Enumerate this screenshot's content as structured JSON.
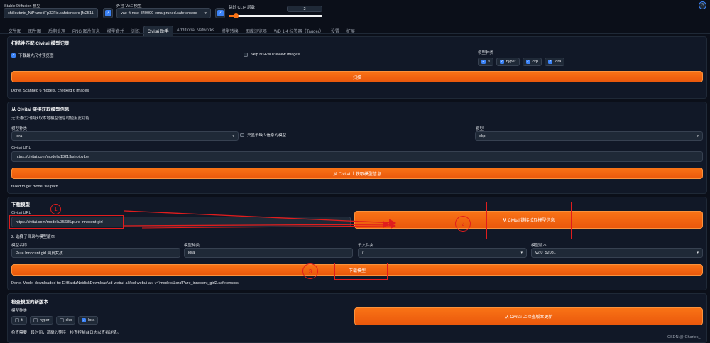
{
  "header": {
    "model_label": "Stable Diffusion 模型",
    "model_value": "chilloutmix_NiPrunedFp32Fix.safetensors [fc2511",
    "vae_label": "外挂 VAE 模型",
    "vae_value": "vae-ft-mse-840000-ema-pruned.safetensors",
    "clip_label": "跳过 CLIP 层数",
    "clip_value": "2",
    "clip_fraction": 0.083
  },
  "tabs": [
    "文生图",
    "图生图",
    "后期处理",
    "PNG 图片信息",
    "模型合并",
    "训练",
    "Civitai 助手",
    "Additional Networks",
    "模型转换",
    "图库浏览器",
    "WD 1.4 标签器（Tagger）",
    "设置",
    "扩展"
  ],
  "active_tab": "Civitai 助手",
  "scan": {
    "title": "扫描并匹配 Civitai 模型记录",
    "download_preview_label": "下载最大尺寸预览图",
    "skip_nsfw_label": "Skip NSFW Preview Images",
    "model_types_label": "模型种类",
    "model_types": [
      "ti",
      "hyper",
      "ckp",
      "lora"
    ],
    "scan_button": "扫描",
    "status": "Done. Scanned 6 models, checked 6 images"
  },
  "fetch": {
    "title": "从 Civitai 链接获取模型信息",
    "desc": "无法通过扫描获取本地模型信息时使用此功能",
    "type_label": "模型种类",
    "type_value": "lora",
    "only_missing_label": "只显示缺少信息的模型",
    "model_label": "模型",
    "model_value": "ckp",
    "url_label": "Civitai URL",
    "url_value": "https://civitai.com/models/13213/shojovibe",
    "button": "从 Civitai 上获取模型信息",
    "status": "failed to get model file path"
  },
  "download": {
    "title": "下载模型",
    "url_label": "Civitai URL",
    "url_value": "https://civitai.com/models/35685/pure-innocent-girl",
    "fetch_button": "从 Civitai 链接拉取模型信息",
    "step2_label": "2. 选择子目录与模型版本",
    "name_label": "模型名称",
    "name_value": "Pure Innocent girl 純真女孩",
    "type_label": "模型种类",
    "type_value": "lora",
    "subfolder_label": "子文件夹",
    "subfolder_value": "/",
    "version_label": "模型版本",
    "version_value": "v2.0_52081",
    "download_button": "下载模型",
    "status": "Done. Model downloaded to: E:\\BaiduNetdiskDownload\\sd-webui-aki\\sd-webui-aki-v4\\models\\Lora\\Pure_innocent_girl2.safetensors"
  },
  "update": {
    "title": "检查模型的新版本",
    "types_label": "模型种类",
    "types": [
      {
        "label": "ti",
        "checked": false
      },
      {
        "label": "hyper",
        "checked": false
      },
      {
        "label": "ckp",
        "checked": false
      },
      {
        "label": "lora",
        "checked": true
      }
    ],
    "button": "从 Civitai 上检查版本更新",
    "desc": "检查需要一段时间，请耐心等待，检查控制台日志以查看详情。"
  },
  "annotations": {
    "one": "1",
    "two": "2",
    "three": "3"
  },
  "watermark": "CSDN @-Charles_",
  "colors": {
    "accent": "#f97316",
    "annotation": "#e11d1d",
    "checkbox": "#3b82f6",
    "background": "#0b0f19"
  }
}
